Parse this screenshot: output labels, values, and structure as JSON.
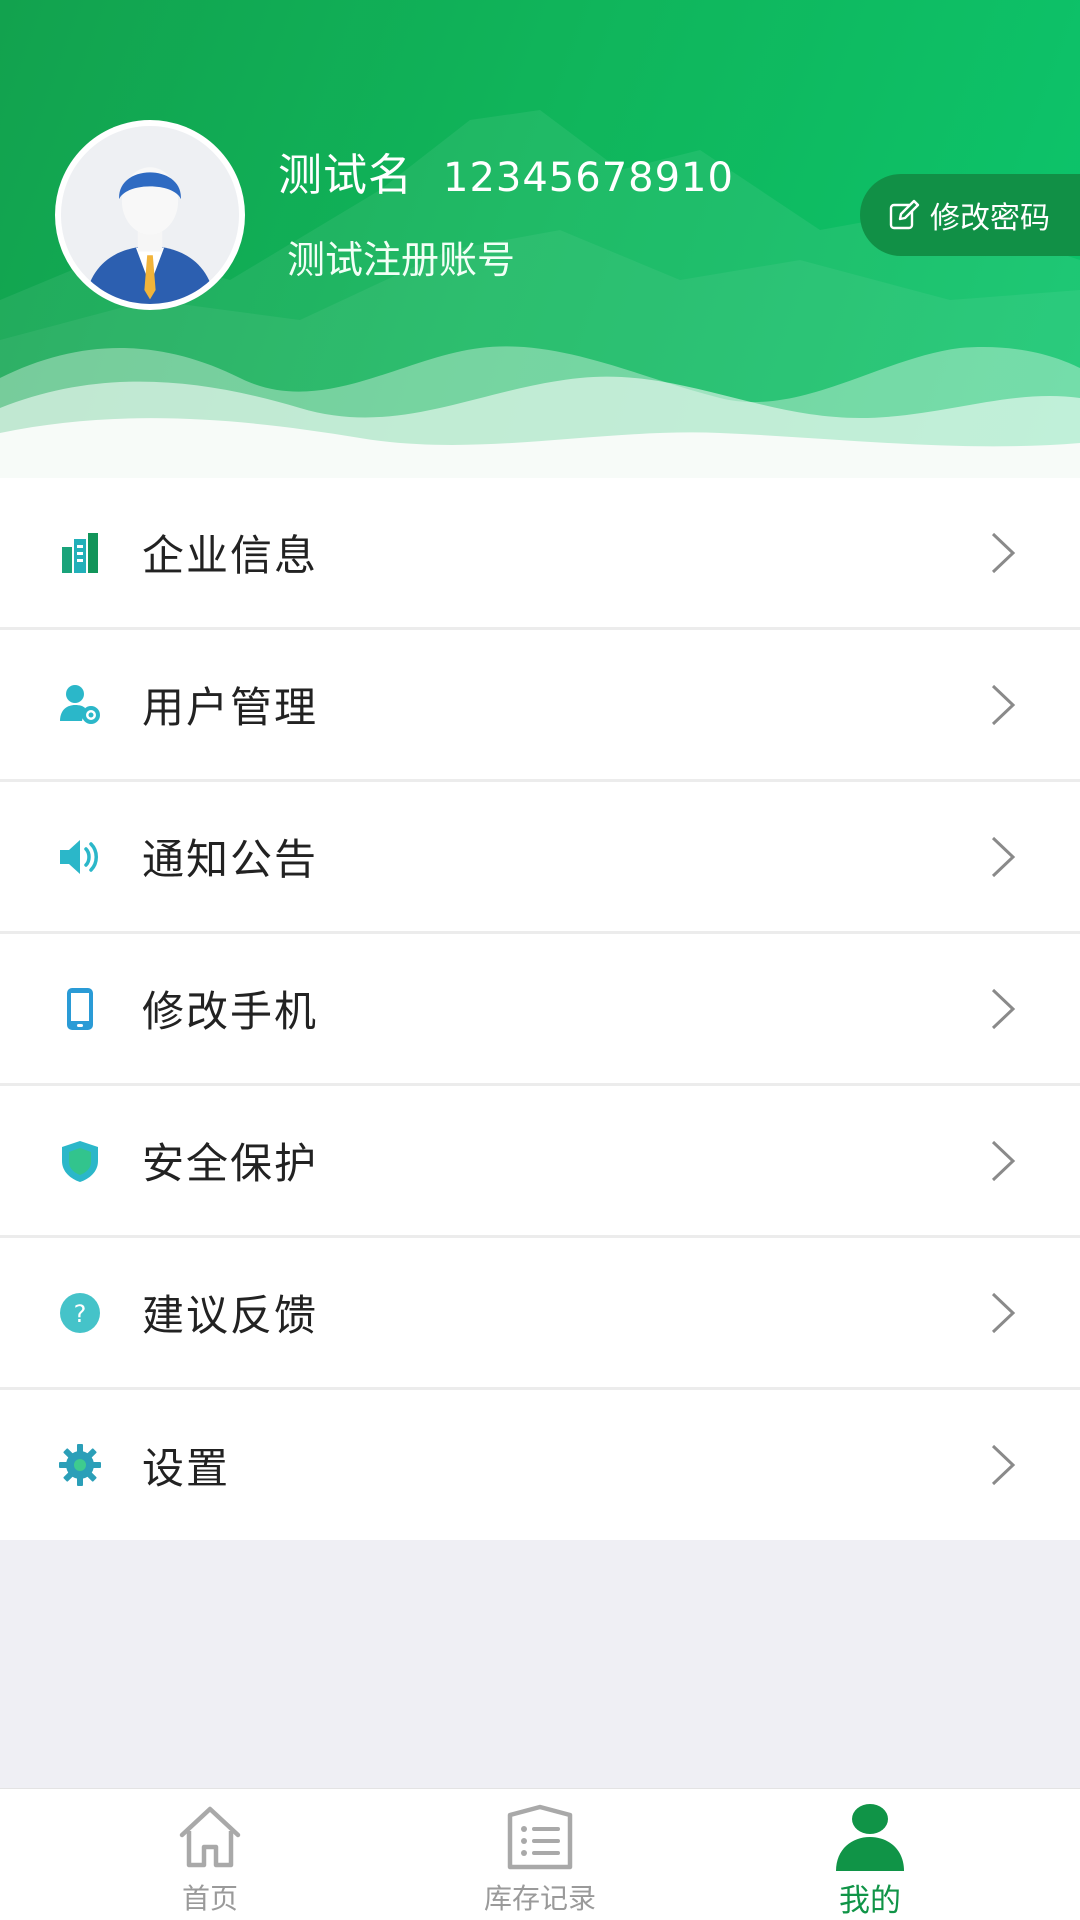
{
  "header": {
    "user_name": "测试名",
    "phone": "12345678910",
    "account_label": "测试注册账号",
    "change_password": "修改密码"
  },
  "menu": {
    "items": [
      {
        "label": "企业信息",
        "icon": "building-icon"
      },
      {
        "label": "用户管理",
        "icon": "user-gear-icon"
      },
      {
        "label": "通知公告",
        "icon": "speaker-icon"
      },
      {
        "label": "修改手机",
        "icon": "phone-icon"
      },
      {
        "label": "安全保护",
        "icon": "shield-icon"
      },
      {
        "label": "建议反馈",
        "icon": "question-icon"
      },
      {
        "label": "设置",
        "icon": "gear-icon"
      }
    ]
  },
  "tabbar": {
    "tabs": [
      {
        "label": "首页",
        "icon": "home-icon",
        "active": false
      },
      {
        "label": "库存记录",
        "icon": "list-icon",
        "active": false
      },
      {
        "label": "我的",
        "icon": "person-icon",
        "active": true
      }
    ]
  },
  "colors": {
    "brand_green": "#109447",
    "header_green": "#12a24e",
    "icon_teal": "#2bb7c9"
  }
}
